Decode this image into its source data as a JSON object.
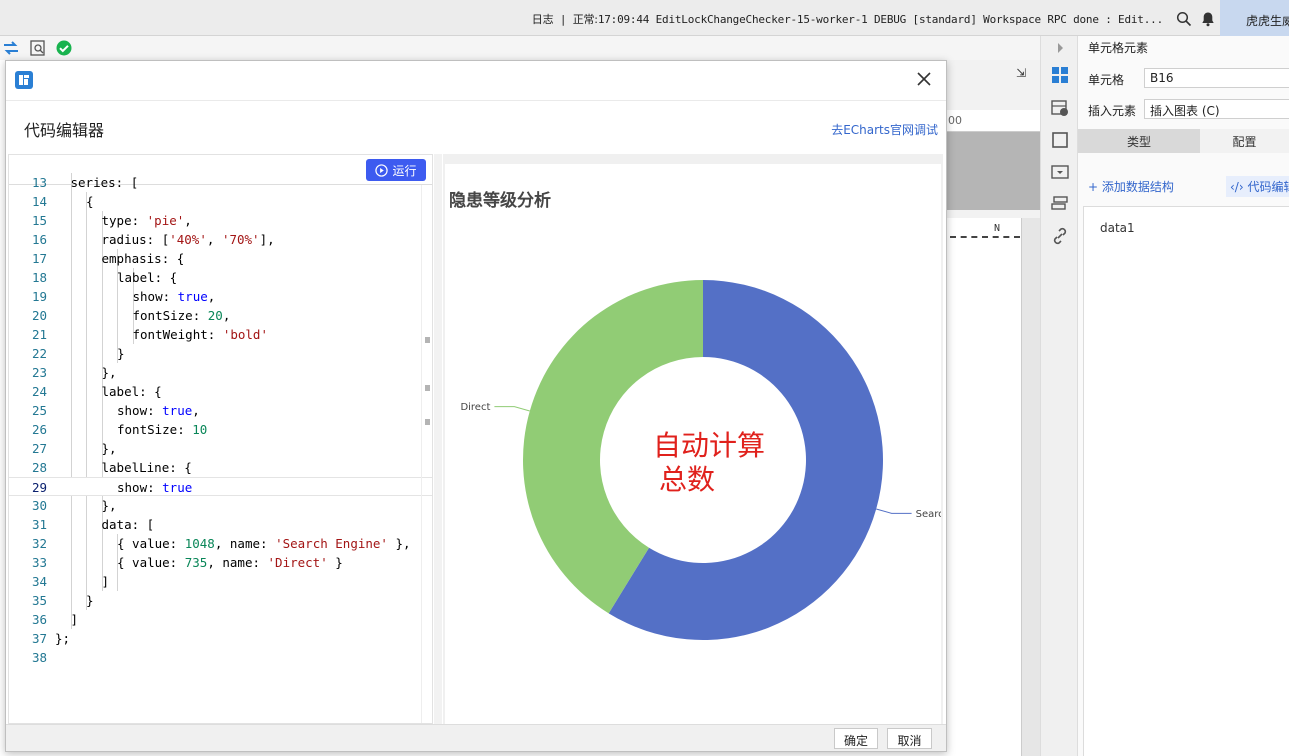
{
  "topbar": {
    "log_label": "日志",
    "separator": "|",
    "status_label": "正常:",
    "status_text": "17:09:44 EditLockChangeChecker-15-worker-1 DEBUG [standard] Workspace RPC done : Edit...",
    "user_name": "虎虎生威"
  },
  "dialog": {
    "title": "代码编辑器",
    "external_link": "去ECharts官网调试",
    "run_label": "运行",
    "confirm_label": "确定",
    "cancel_label": "取消"
  },
  "code_lines": [
    {
      "n": "13",
      "indent": 1,
      "text": "series: ["
    },
    {
      "n": "14",
      "indent": 2,
      "text": "{"
    },
    {
      "n": "15",
      "indent": 3,
      "text": "type: 'pie',"
    },
    {
      "n": "16",
      "indent": 3,
      "text": "radius: ['40%', '70%'],"
    },
    {
      "n": "17",
      "indent": 3,
      "text": "emphasis: {"
    },
    {
      "n": "18",
      "indent": 4,
      "text": "label: {"
    },
    {
      "n": "19",
      "indent": 5,
      "text": "show: true,"
    },
    {
      "n": "20",
      "indent": 5,
      "text": "fontSize: 20,"
    },
    {
      "n": "21",
      "indent": 5,
      "text": "fontWeight: 'bold'"
    },
    {
      "n": "22",
      "indent": 4,
      "text": "}"
    },
    {
      "n": "23",
      "indent": 3,
      "text": "},"
    },
    {
      "n": "24",
      "indent": 3,
      "text": "label: {"
    },
    {
      "n": "25",
      "indent": 4,
      "text": "show: true,"
    },
    {
      "n": "26",
      "indent": 4,
      "text": "fontSize: 10"
    },
    {
      "n": "27",
      "indent": 3,
      "text": "},"
    },
    {
      "n": "28",
      "indent": 3,
      "text": "labelLine: {"
    },
    {
      "n": "29",
      "indent": 4,
      "text": "show: true"
    },
    {
      "n": "30",
      "indent": 3,
      "text": "},"
    },
    {
      "n": "31",
      "indent": 3,
      "text": "data: ["
    },
    {
      "n": "32",
      "indent": 4,
      "text": "{ value: 1048, name: 'Search Engine' },"
    },
    {
      "n": "33",
      "indent": 4,
      "text": "{ value: 735, name: 'Direct' }"
    },
    {
      "n": "34",
      "indent": 3,
      "text": "]"
    },
    {
      "n": "35",
      "indent": 2,
      "text": "}"
    },
    {
      "n": "36",
      "indent": 1,
      "text": "]"
    },
    {
      "n": "37",
      "indent": 0,
      "text": "};"
    },
    {
      "n": "38",
      "indent": 0,
      "text": ""
    }
  ],
  "current_line": "29",
  "chart_data": {
    "type": "pie",
    "variant": "donut",
    "title": "隐患等级分析",
    "radius": [
      "40%",
      "70%"
    ],
    "series": [
      {
        "name": "Search Engine",
        "value": 1048,
        "color": "#5470c6",
        "label": "Searc..."
      },
      {
        "name": "Direct",
        "value": 735,
        "color": "#91cc75",
        "label": "Direct"
      }
    ],
    "center_text_line1": "自动计算",
    "center_text_line2": "总数"
  },
  "background": {
    "ruler_text": "00",
    "column_marker": "N"
  },
  "right_panel": {
    "title": "单元格元素",
    "cell_label": "单元格",
    "cell_value": "B16",
    "insert_label": "插入元素",
    "insert_value": "插入图表 (C)",
    "tab_type": "类型",
    "tab_config": "配置",
    "add_data_structure": "+ 添加数据结构",
    "code_editor_link": "‹/› 代码编辑",
    "data_item": "data1"
  },
  "colors": {
    "accent": "#3d5bf0",
    "link": "#3366cc",
    "annotation": "#e0211c"
  }
}
